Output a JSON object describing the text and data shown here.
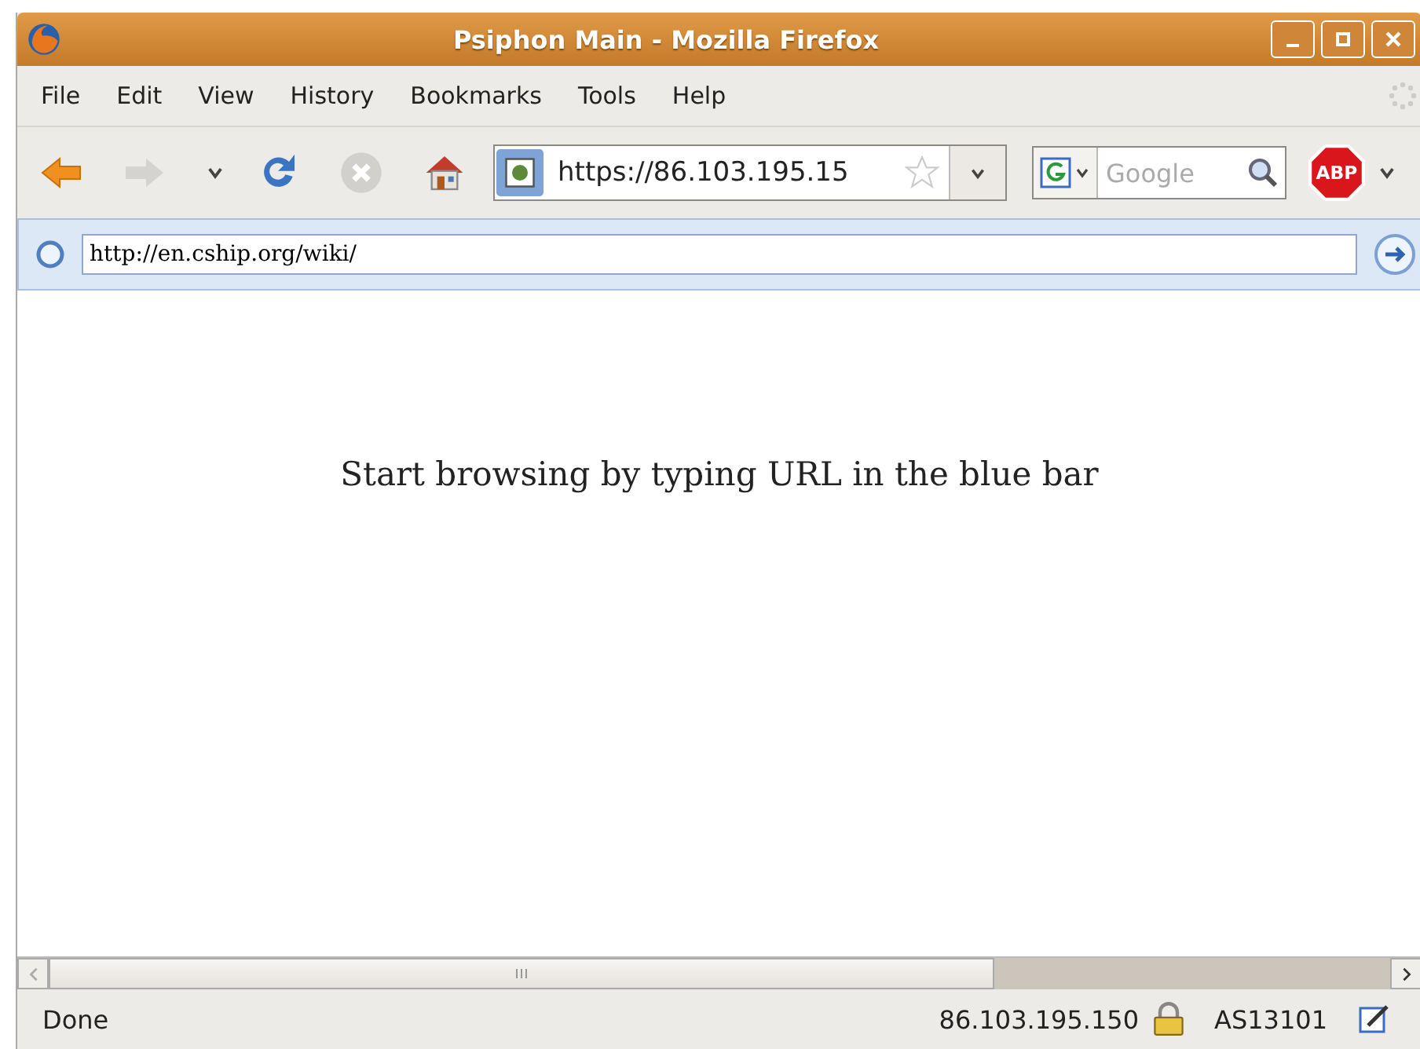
{
  "window": {
    "title": "Psiphon Main - Mozilla Firefox"
  },
  "menu": [
    "File",
    "Edit",
    "View",
    "History",
    "Bookmarks",
    "Tools",
    "Help"
  ],
  "toolbar": {
    "back_enabled": true,
    "forward_enabled": false,
    "address": "https://86.103.195.15",
    "search_placeholder": "Google",
    "adblock_label": "ABP"
  },
  "blue_bar": {
    "value": "http://en.cship.org/wiki/"
  },
  "content": {
    "message": "Start browsing by typing URL in the blue bar"
  },
  "status_bar": {
    "status": "Done",
    "ip": "86.103.195.150",
    "as": "AS13101"
  }
}
